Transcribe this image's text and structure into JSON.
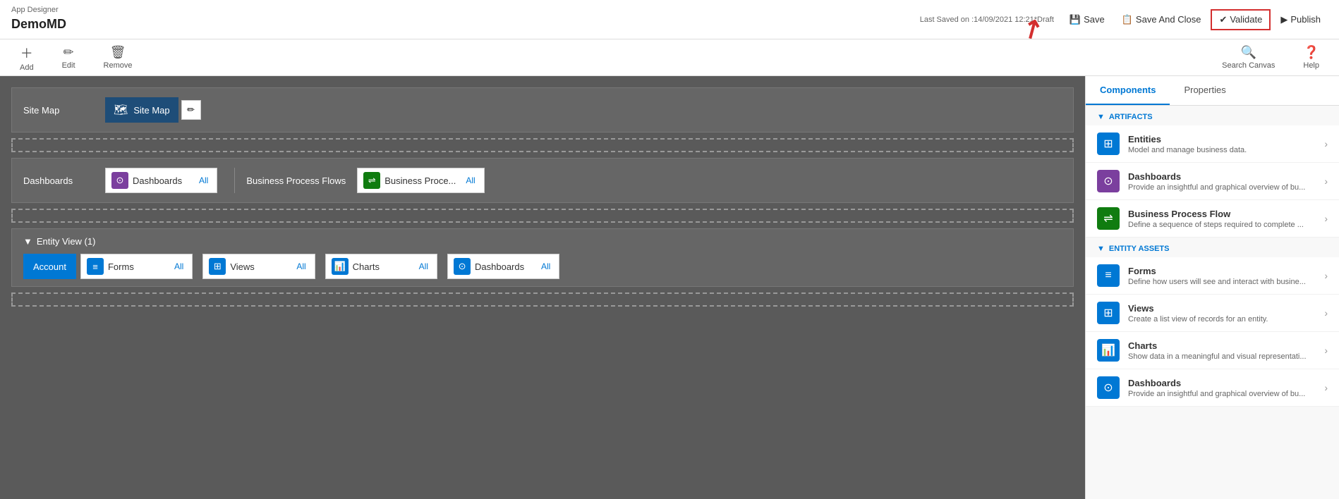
{
  "header": {
    "app_label": "App Designer",
    "app_name": "DemoMD",
    "last_saved": "Last Saved on :14/09/2021 12:21",
    "draft_label": "*Draft",
    "save_label": "Save",
    "save_close_label": "Save And Close",
    "validate_label": "Validate",
    "publish_label": "Publish"
  },
  "toolbar": {
    "add_label": "Add",
    "edit_label": "Edit",
    "remove_label": "Remove",
    "search_label": "Search Canvas",
    "help_label": "Help"
  },
  "canvas": {
    "site_map_label": "Site Map",
    "site_map_name": "Site Map",
    "dashboards_label": "Dashboards",
    "dashboards_name": "Dashboards",
    "dashboards_all": "All",
    "bpf_label": "Business Process Flows",
    "bpf_name": "Business Proce...",
    "bpf_all": "All",
    "entity_section_label": "Entity View (1)",
    "account_label": "Account",
    "forms_name": "Forms",
    "forms_all": "All",
    "views_name": "Views",
    "views_all": "All",
    "charts_name": "Charts",
    "charts_all": "All",
    "dashboards2_name": "Dashboards",
    "dashboards2_all": "All"
  },
  "right_panel": {
    "tab_components": "Components",
    "tab_properties": "Properties",
    "artifacts_label": "ARTIFACTS",
    "entities_title": "Entities",
    "entities_desc": "Model and manage business data.",
    "dashboards_title": "Dashboards",
    "dashboards_desc": "Provide an insightful and graphical overview of bu...",
    "bpf_title": "Business Process Flow",
    "bpf_desc": "Define a sequence of steps required to complete ...",
    "entity_assets_label": "ENTITY ASSETS",
    "forms_title": "Forms",
    "forms_desc": "Define how users will see and interact with busine...",
    "views_title": "Views",
    "views_desc": "Create a list view of records for an entity.",
    "charts_title": "Charts",
    "charts_desc": "Show data in a meaningful and visual representati...",
    "dashboards2_title": "Dashboards",
    "dashboards2_desc": "Provide an insightful and graphical overview of bu..."
  }
}
